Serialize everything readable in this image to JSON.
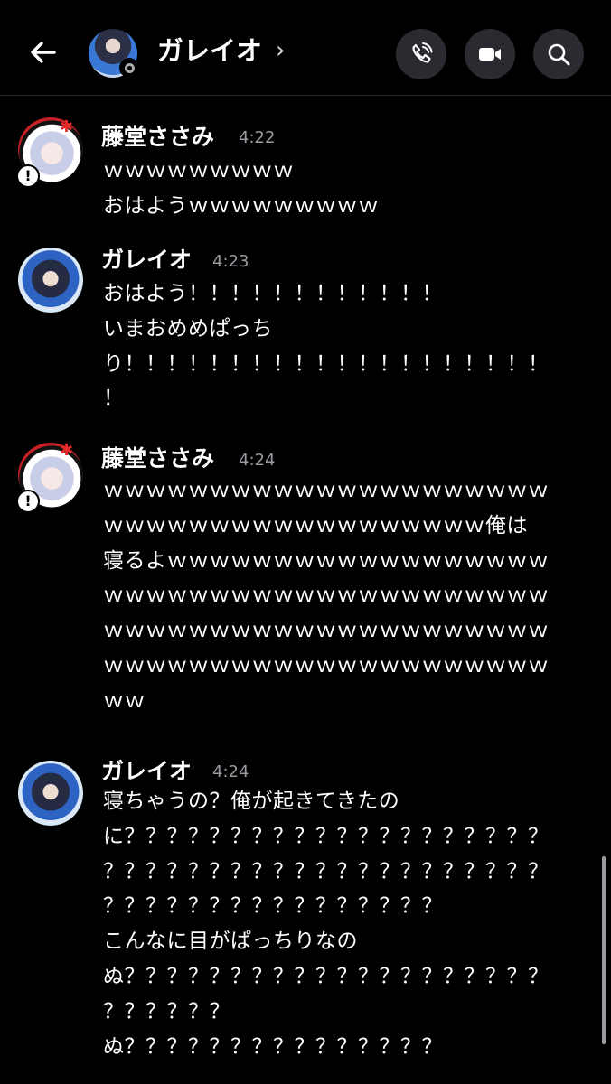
{
  "header": {
    "title": "ガレイオ",
    "chevron": "›",
    "icons": [
      "back-arrow-icon",
      "phone-icon",
      "video-camera-icon",
      "search-icon"
    ]
  },
  "messages": [
    {
      "author": "藤堂ささみ",
      "time": "4:22",
      "text": "ｗｗｗｗｗｗｗｗｗ\nおはようｗｗｗｗｗｗｗｗｗ"
    },
    {
      "author": "ガレイオ",
      "time": "4:23",
      "text": "おはよう！！！！！！！！！！！！\nいまおめめぱっち\nり！！！！！！！！！！！！！！！！！！！！\n！"
    },
    {
      "author": "藤堂ささみ",
      "time": "4:24",
      "text": "ｗｗｗｗｗｗｗｗｗｗｗｗｗｗｗｗｗｗｗｗｗ\nｗｗｗｗｗｗｗｗｗｗｗｗｗｗｗｗｗｗ俺は\n寝るよｗｗｗｗｗｗｗｗｗｗｗｗｗｗｗｗｗｗ\nｗｗｗｗｗｗｗｗｗｗｗｗｗｗｗｗｗｗｗｗｗ\nｗｗｗｗｗｗｗｗｗｗｗｗｗｗｗｗｗｗｗｗｗ\nｗｗｗｗｗｗｗｗｗｗｗｗｗｗｗｗｗｗｗｗｗ\nｗｗ"
    },
    {
      "author": "ガレイオ",
      "time": "4:24",
      "text": "寝ちゃうの？俺が起きてきたの\nに？？？？？？？？？？？？？？？？？？？？\n？？？？？？？？？？？？？？？？？？？？？\n？？？？？？？？？？？？？？？？\nこんなに目がぱっちりなの\nぬ？？？？？？？？？？？？？？？？？？？？\n？？？？？？\nぬ？？？？？？？？？？？？？？？"
    }
  ],
  "colors": {
    "background": "#000000",
    "text": "#ffffff",
    "timestamp": "#9a9aa2",
    "header_button": "#2a2b30"
  }
}
